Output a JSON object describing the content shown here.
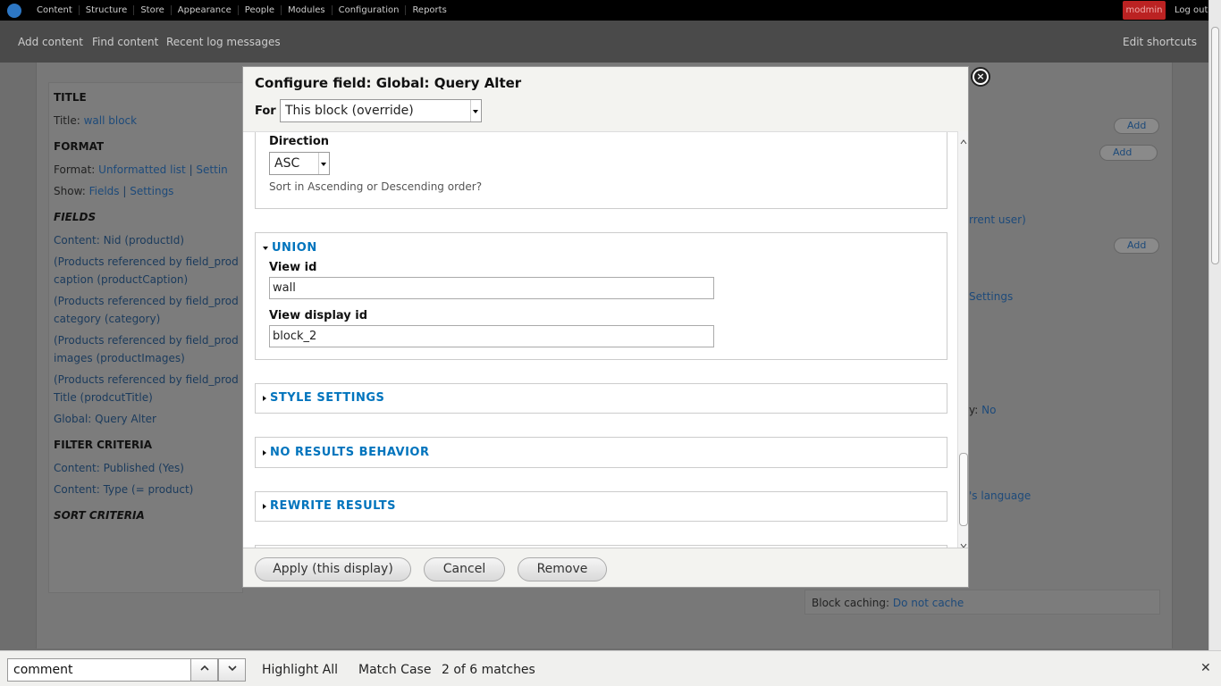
{
  "toolbar": {
    "menu": [
      "Content",
      "Structure",
      "Store",
      "Appearance",
      "People",
      "Modules",
      "Configuration",
      "Reports"
    ],
    "user": "modmin",
    "logout": "Log out"
  },
  "shortcuts": {
    "add_content": "Add content",
    "find_content": "Find content",
    "recent_log": "Recent log messages",
    "edit_shortcuts": "Edit shortcuts"
  },
  "page": {
    "title_head": "TITLE",
    "title_label": "Title:",
    "title_value": "wall block",
    "format_head": "FORMAT",
    "format_label": "Format:",
    "format_value": "Unformatted list",
    "format_settings": "Settin",
    "show_label": "Show:",
    "show_fields": "Fields",
    "show_settings": "Settings",
    "fields_head": "FIELDS",
    "fields": [
      "Content: Nid (productId)",
      "(Products referenced by field_prod",
      "caption (productCaption)",
      "(Products referenced by field_prod",
      "category (category)",
      "(Products referenced by field_prod",
      "images (productImages)",
      "(Products referenced by field_prod",
      "Title (prodcutTitle)",
      "Global: Query Alter"
    ],
    "filter_head": "FILTER CRITERIA",
    "filters": [
      "Content: Published (Yes)",
      "Content: Type (= product)"
    ],
    "sort_head": "SORT CRITERIA",
    "right_add1": "Add",
    "right_add2": "Add",
    "right_add3": "Add",
    "right_current_user": "rrent user)",
    "right_settings": "Settings",
    "right_no_label": "y:",
    "right_no": "No",
    "right_language": "'s language",
    "block_caching_label": "Block caching:",
    "block_caching_value": "Do not cache"
  },
  "dialog": {
    "title": "Configure field: Global: Query Alter",
    "for_label": "For",
    "for_value": "This block (override)",
    "direction_label": "Direction",
    "direction_value": "ASC",
    "direction_desc": "Sort in Ascending or Descending order?",
    "union_title": "UNION",
    "view_id_label": "View id",
    "view_id_value": "wall",
    "view_display_label": "View display id",
    "view_display_value": "block_2",
    "style_settings": "STYLE SETTINGS",
    "no_results": "NO RESULTS BEHAVIOR",
    "rewrite_results": "REWRITE RESULTS",
    "apply_btn": "Apply (this display)",
    "cancel_btn": "Cancel",
    "remove_btn": "Remove"
  },
  "findbar": {
    "query": "comment",
    "highlight_all": "Highlight All",
    "match_case": "Match Case",
    "matches": "2 of 6 matches",
    "close": "✕"
  }
}
